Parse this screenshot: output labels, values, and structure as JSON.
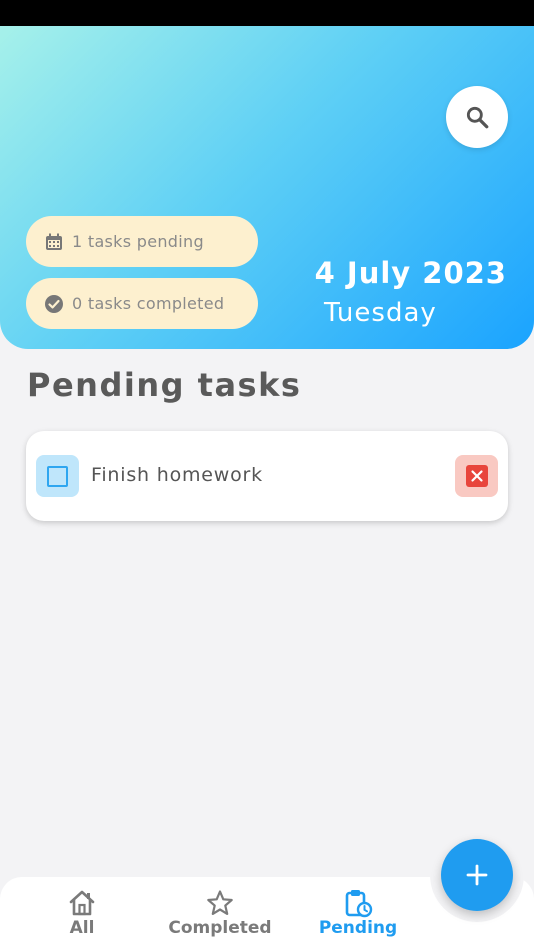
{
  "header": {
    "pending_summary": "1 tasks pending",
    "completed_summary": "0 tasks completed",
    "date": "4 July 2023",
    "weekday": "Tuesday",
    "search_icon": "search-icon"
  },
  "main": {
    "section_title": "Pending tasks",
    "tasks": [
      {
        "title": "Finish homework",
        "completed": false
      }
    ]
  },
  "bottom_nav": {
    "items": [
      {
        "label": "All",
        "icon": "home-icon",
        "active": false
      },
      {
        "label": "Completed",
        "icon": "star-icon",
        "active": false
      },
      {
        "label": "Pending",
        "icon": "clipboard-clock-icon",
        "active": true
      }
    ],
    "fab_icon": "plus-icon"
  },
  "colors": {
    "accent": "#1f9cf0",
    "pill_bg": "#fdf0cf",
    "delete": "#e8453c"
  }
}
